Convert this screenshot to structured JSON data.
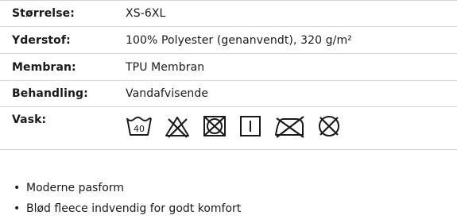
{
  "specs": [
    {
      "label": "Størrelse:",
      "value": "XS-6XL"
    },
    {
      "label": "Yderstof:",
      "value": "100% Polyester (genanvendt), 320 g/m²"
    },
    {
      "label": "Membran:",
      "value": "TPU Membran"
    },
    {
      "label": "Behandling:",
      "value": "Vandafvisende"
    },
    {
      "label": "Vask:"
    }
  ],
  "care": {
    "wash_temperature": "40",
    "icons": [
      "wash-40-icon",
      "do-not-bleach-icon",
      "do-not-tumble-dry-icon",
      "line-dry-icon",
      "do-not-iron-icon",
      "do-not-dry-clean-icon"
    ]
  },
  "features": [
    "Moderne pasform",
    "Blød fleece indvendig for godt komfort"
  ]
}
